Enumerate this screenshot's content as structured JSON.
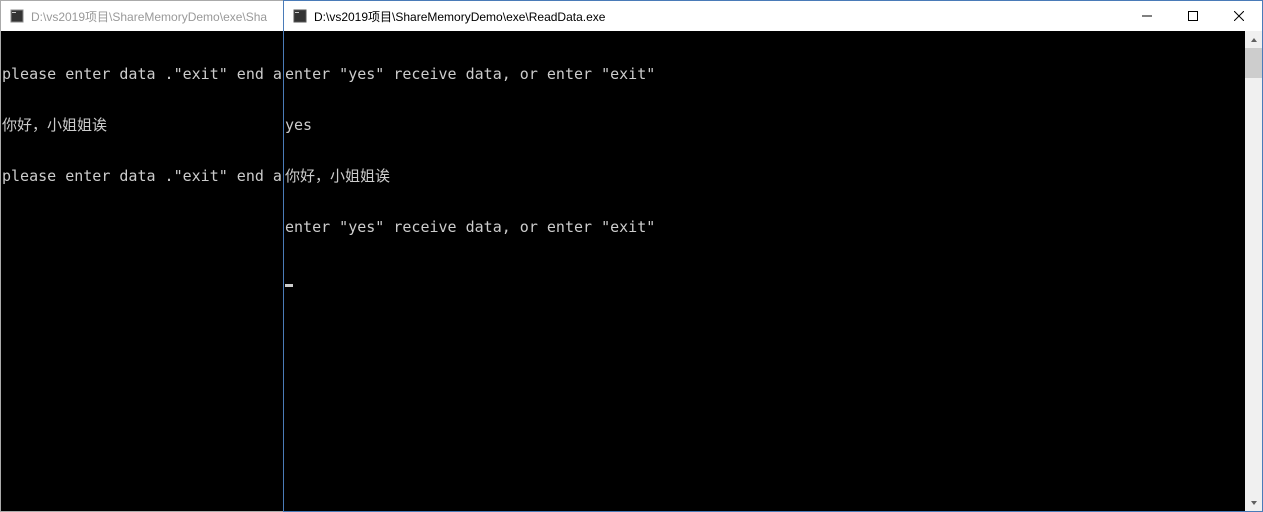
{
  "leftWindow": {
    "title": "D:\\vs2019项目\\ShareMemoryDemo\\exe\\Sha",
    "lines": [
      "please enter data .\"exit\" end app",
      "你好，小姐姐诶",
      "please enter data .\"exit\" end app"
    ]
  },
  "rightWindow": {
    "title": "D:\\vs2019项目\\ShareMemoryDemo\\exe\\ReadData.exe",
    "lines": [
      "enter \"yes\" receive data, or enter \"exit\"",
      "yes",
      "你好，小姐姐诶",
      "enter \"yes\" receive data, or enter \"exit\""
    ]
  }
}
